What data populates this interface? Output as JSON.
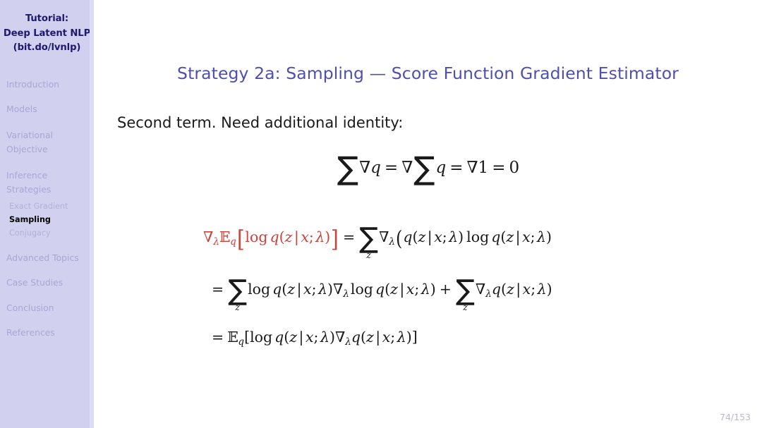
{
  "sidebar": {
    "header_lines": [
      "Tutorial:",
      "Deep Latent NLP",
      "(bit.do/lvnlp)"
    ],
    "sections": [
      {
        "label": "Introduction",
        "active": false
      },
      {
        "label": "Models",
        "active": false
      },
      {
        "label": "Variational Objective",
        "active": false
      },
      {
        "label": "Inference Strategies",
        "active": false
      },
      {
        "label": "Advanced Topics",
        "active": false
      },
      {
        "label": "Case Studies",
        "active": false
      },
      {
        "label": "Conclusion",
        "active": false
      },
      {
        "label": "References",
        "active": false
      }
    ],
    "subsections": [
      {
        "label": "Exact Gradient",
        "active": false
      },
      {
        "label": "Sampling",
        "active": true
      },
      {
        "label": "Conjugacy",
        "active": false
      }
    ],
    "section_labels": {
      "introduction": "Introduction",
      "models": "Models",
      "variational_line1": "Variational",
      "variational_line2": "Objective",
      "inference_line1": "Inference",
      "inference_line2": "Strategies",
      "advanced_topics": "Advanced Topics",
      "case_studies": "Case Studies",
      "conclusion": "Conclusion",
      "references": "References",
      "exact_gradient": "Exact Gradient",
      "sampling": "Sampling",
      "conjugacy": "Conjugacy"
    }
  },
  "main": {
    "title": "Strategy 2a: Sampling — Score Function Gradient Estimator",
    "body_text": "Second term.  Need additional identity:",
    "equation_identity": {
      "latex": "\\sum \\nabla q = \\nabla \\sum q = \\nabla 1 = 0",
      "plain": "∑ ∇q = ∇ ∑ q = ∇1 = 0",
      "parts": {
        "sum_symbol": "∑",
        "nabla": "∇",
        "q": "q",
        "equals": "=",
        "one": "1",
        "zero": "0"
      }
    },
    "derivation": {
      "line1": {
        "lhs_plain": "∇_λ 𝔼_q [ log q(z | x; λ) ]",
        "rhs_plain": "= ∑_z ∇_λ ( q(z | x; λ) log q(z | x; λ)",
        "lhs_highlighted": true,
        "highlight_color": "#c8433c"
      },
      "line2": {
        "plain": "= ∑_z log q(z | x; λ) ∇_λ log q(z | x; λ) + ∑_z ∇_λ q(z | x; λ)"
      },
      "line3": {
        "plain": "= 𝔼_q [ log q(z | x; λ) ∇_λ q(z | x; λ) ]"
      },
      "tokens": {
        "nabla": "∇",
        "lambda": "λ",
        "expectation": "𝔼",
        "q": "q",
        "z": "z",
        "x": "x",
        "log": "log",
        "sum": "∑",
        "mid": "|",
        "semicolon": ";",
        "equals": "=",
        "plus": "+",
        "lbracket": "[",
        "rbracket": "]",
        "lparen": "(",
        "rparen": ")"
      }
    }
  },
  "footer": {
    "page_number": "74/153"
  },
  "colors": {
    "sidebar_bg": "#d2d0ef",
    "sidebar_edge": "#dedcf4",
    "sidebar_header_text": "#1d1a6e",
    "sidebar_item_text": "#a9a6d4",
    "sidebar_active_text": "#000000",
    "title_text": "#4f4fae",
    "body_text": "#1a1a1a",
    "highlight_red": "#c8433c",
    "page_number_text": "#b9b6dd",
    "slide_bg": "#ffffff"
  }
}
